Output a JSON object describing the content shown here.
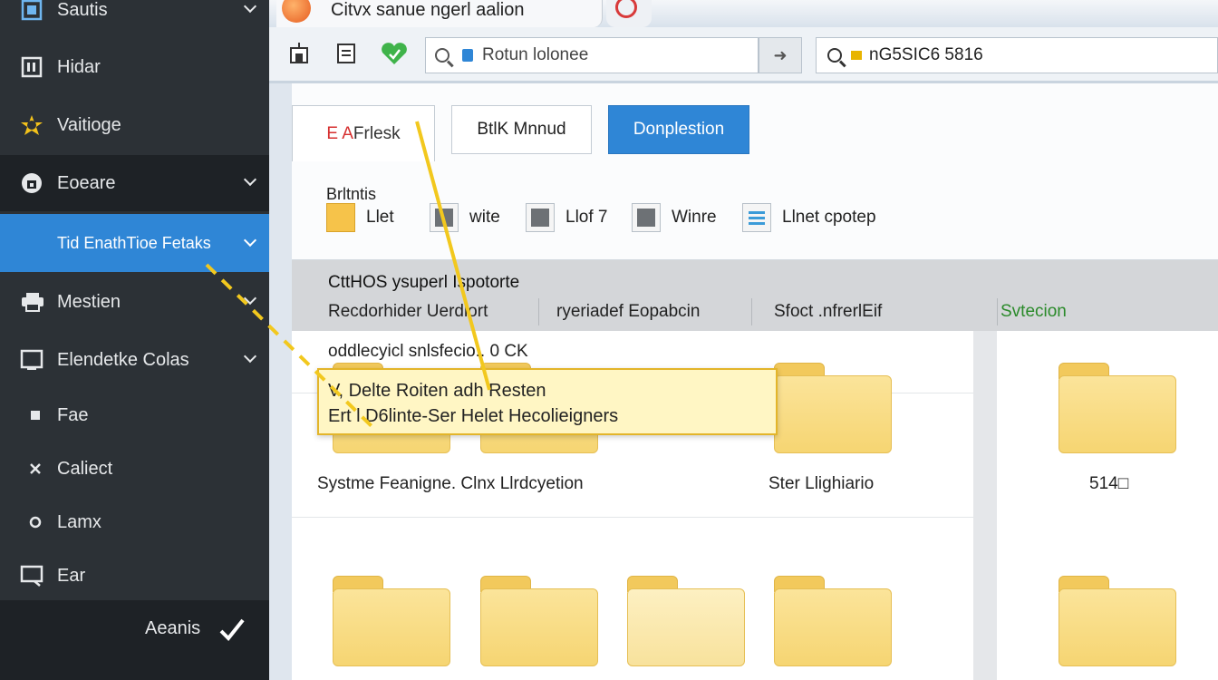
{
  "sidebar": {
    "items": [
      {
        "label": "Sautis",
        "icon": "grid-icon"
      },
      {
        "label": "Hidar",
        "icon": "window-icon"
      },
      {
        "label": "Vaitioge",
        "icon": "star-icon"
      },
      {
        "label": "Eoeare",
        "icon": "lock-icon"
      },
      {
        "label": "Tid EnathTioe Fetaks",
        "icon": ""
      },
      {
        "label": "Mestien",
        "icon": "printer-icon"
      },
      {
        "label": "Elendetke Colas",
        "icon": "frame-icon"
      },
      {
        "label": "Fae",
        "icon": "bullet-icon"
      },
      {
        "label": "Caliect",
        "icon": "cross-icon"
      },
      {
        "label": "Lamx",
        "icon": "diamond-icon"
      },
      {
        "label": "Ear",
        "icon": "monitor-icon"
      },
      {
        "label": "Aeanis",
        "icon": "check-icon"
      }
    ]
  },
  "window": {
    "title": "Citvx sanue ngerl aalion"
  },
  "toolbar": {
    "address_value": "Rotun lolonee",
    "search_value": "nG5SIC6 5816"
  },
  "ribbon": {
    "tabs": [
      {
        "label_red": "E A",
        "label": " Frlesk"
      },
      {
        "label": "BtlK Mnnud"
      },
      {
        "label": "Donplestion"
      }
    ],
    "group_label": "Brltntis",
    "items": [
      {
        "label": "Llet",
        "icon": "folder-icon"
      },
      {
        "label": "wite",
        "icon": "image-icon"
      },
      {
        "label": "Llof 7",
        "icon": "scanner-icon"
      },
      {
        "label": "Winre",
        "icon": "box-icon"
      },
      {
        "label": "Llnet cpotep",
        "icon": "document-icon"
      }
    ]
  },
  "content": {
    "title": "CttHOS ysuperl Ispotorte",
    "columns": [
      "Recdorhider Uerdiort",
      "ryeriadef Eopabcin",
      "Sfoct .nfrerlEif",
      "Svtecion"
    ],
    "row1": "oddlecyicl snlsfecio..   0 CK",
    "row2": [
      "Systme Feanigne.  Clnx Llrdcyetion",
      "Ster Llighiario",
      "514□"
    ]
  },
  "tooltip": {
    "line1": "V,   Delte Roiten adh Resten",
    "line2": "Ert l D6linte-Ser Helet Hecolieigners"
  },
  "colors": {
    "accent": "#2f86d6",
    "sidebar_bg": "#2c3136",
    "tooltip_border": "#e3b52a",
    "folder": "#f6d572"
  }
}
